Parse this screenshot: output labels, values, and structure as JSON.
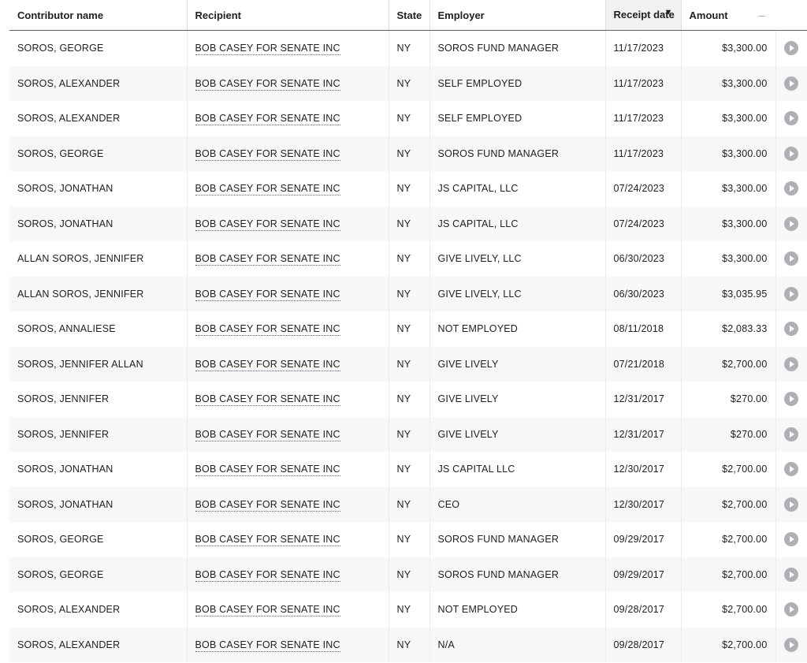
{
  "table": {
    "headers": {
      "contributor": "Contributor name",
      "recipient": "Recipient",
      "state": "State",
      "employer": "Employer",
      "receipt_date": "Receipt date",
      "amount": "Amount",
      "amount_collapse": "–"
    },
    "rows": [
      {
        "contributor": "SOROS, GEORGE",
        "recipient": "BOB CASEY FOR SENATE INC",
        "state": "NY",
        "employer": "SOROS FUND MANAGER",
        "date": "11/17/2023",
        "amount": "$3,300.00"
      },
      {
        "contributor": "SOROS, ALEXANDER",
        "recipient": "BOB CASEY FOR SENATE INC",
        "state": "NY",
        "employer": "SELF EMPLOYED",
        "date": "11/17/2023",
        "amount": "$3,300.00"
      },
      {
        "contributor": "SOROS, ALEXANDER",
        "recipient": "BOB CASEY FOR SENATE INC",
        "state": "NY",
        "employer": "SELF EMPLOYED",
        "date": "11/17/2023",
        "amount": "$3,300.00"
      },
      {
        "contributor": "SOROS, GEORGE",
        "recipient": "BOB CASEY FOR SENATE INC",
        "state": "NY",
        "employer": "SOROS FUND MANAGER",
        "date": "11/17/2023",
        "amount": "$3,300.00"
      },
      {
        "contributor": "SOROS, JONATHAN",
        "recipient": "BOB CASEY FOR SENATE INC",
        "state": "NY",
        "employer": "JS CAPITAL, LLC",
        "date": "07/24/2023",
        "amount": "$3,300.00"
      },
      {
        "contributor": "SOROS, JONATHAN",
        "recipient": "BOB CASEY FOR SENATE INC",
        "state": "NY",
        "employer": "JS CAPITAL, LLC",
        "date": "07/24/2023",
        "amount": "$3,300.00"
      },
      {
        "contributor": "ALLAN SOROS, JENNIFER",
        "recipient": "BOB CASEY FOR SENATE INC",
        "state": "NY",
        "employer": "GIVE LIVELY, LLC",
        "date": "06/30/2023",
        "amount": "$3,300.00"
      },
      {
        "contributor": "ALLAN SOROS, JENNIFER",
        "recipient": "BOB CASEY FOR SENATE INC",
        "state": "NY",
        "employer": "GIVE LIVELY, LLC",
        "date": "06/30/2023",
        "amount": "$3,035.95"
      },
      {
        "contributor": "SOROS, ANNALIESE",
        "recipient": "BOB CASEY FOR SENATE INC",
        "state": "NY",
        "employer": "NOT EMPLOYED",
        "date": "08/11/2018",
        "amount": "$2,083.33"
      },
      {
        "contributor": "SOROS, JENNIFER ALLAN",
        "recipient": "BOB CASEY FOR SENATE INC",
        "state": "NY",
        "employer": "GIVE LIVELY",
        "date": "07/21/2018",
        "amount": "$2,700.00"
      },
      {
        "contributor": "SOROS, JENNIFER",
        "recipient": "BOB CASEY FOR SENATE INC",
        "state": "NY",
        "employer": "GIVE LIVELY",
        "date": "12/31/2017",
        "amount": "$270.00"
      },
      {
        "contributor": "SOROS, JENNIFER",
        "recipient": "BOB CASEY FOR SENATE INC",
        "state": "NY",
        "employer": "GIVE LIVELY",
        "date": "12/31/2017",
        "amount": "$270.00"
      },
      {
        "contributor": "SOROS, JONATHAN",
        "recipient": "BOB CASEY FOR SENATE INC",
        "state": "NY",
        "employer": "JS CAPITAL LLC",
        "date": "12/30/2017",
        "amount": "$2,700.00"
      },
      {
        "contributor": "SOROS, JONATHAN",
        "recipient": "BOB CASEY FOR SENATE INC",
        "state": "NY",
        "employer": "CEO",
        "date": "12/30/2017",
        "amount": "$2,700.00"
      },
      {
        "contributor": "SOROS, GEORGE",
        "recipient": "BOB CASEY FOR SENATE INC",
        "state": "NY",
        "employer": "SOROS FUND MANAGER",
        "date": "09/29/2017",
        "amount": "$2,700.00"
      },
      {
        "contributor": "SOROS, GEORGE",
        "recipient": "BOB CASEY FOR SENATE INC",
        "state": "NY",
        "employer": "SOROS FUND MANAGER",
        "date": "09/29/2017",
        "amount": "$2,700.00"
      },
      {
        "contributor": "SOROS, ALEXANDER",
        "recipient": "BOB CASEY FOR SENATE INC",
        "state": "NY",
        "employer": "NOT EMPLOYED",
        "date": "09/28/2017",
        "amount": "$2,700.00"
      },
      {
        "contributor": "SOROS, ALEXANDER",
        "recipient": "BOB CASEY FOR SENATE INC",
        "state": "NY",
        "employer": "N/A",
        "date": "09/28/2017",
        "amount": "$2,700.00"
      }
    ],
    "row_action_icon": "play-circle-icon",
    "sort_icon": "sort-descending-icon"
  }
}
